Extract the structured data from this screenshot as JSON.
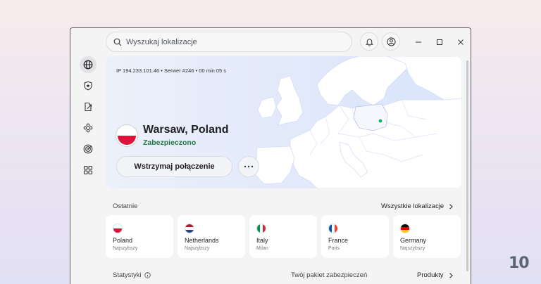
{
  "search": {
    "placeholder": "Wyszukaj lokalizacje"
  },
  "topbar": {
    "icons": [
      "bell-icon",
      "account-icon",
      "minimize-icon",
      "maximize-icon",
      "close-icon"
    ]
  },
  "sidebar": {
    "items": [
      {
        "name": "globe-icon",
        "active": true
      },
      {
        "name": "shield-icon",
        "active": false
      },
      {
        "name": "split-tunnel-icon",
        "active": false
      },
      {
        "name": "mesh-icon",
        "active": false
      },
      {
        "name": "radar-icon",
        "active": false
      },
      {
        "name": "apps-grid-icon",
        "active": false
      }
    ]
  },
  "connection": {
    "ip_line": "IP 194.233.101.46 • Serwer #246 • 00 min 05 s",
    "location": "Warsaw, Poland",
    "status": "Zabezpieczono",
    "pause_label": "Wstrzymaj połączenie",
    "more_label": "⋯"
  },
  "recent": {
    "title": "Ostatnie",
    "all_link": "Wszystkie lokalizacje",
    "items": [
      {
        "name": "Poland",
        "sub": "Najszybszy",
        "flag": [
          "#ffffff",
          "#dc143c"
        ],
        "dir": "h"
      },
      {
        "name": "Netherlands",
        "sub": "Najszybszy",
        "flag": [
          "#ae1c28",
          "#ffffff",
          "#21468b"
        ],
        "dir": "h"
      },
      {
        "name": "Italy",
        "sub": "Milan",
        "flag": [
          "#009246",
          "#ffffff",
          "#ce2b37"
        ],
        "dir": "v"
      },
      {
        "name": "France",
        "sub": "Paris",
        "flag": [
          "#0055a4",
          "#ffffff",
          "#ef4135"
        ],
        "dir": "v"
      },
      {
        "name": "Germany",
        "sub": "Najszybszy",
        "flag": [
          "#000000",
          "#dd0000",
          "#ffce00"
        ],
        "dir": "h"
      }
    ]
  },
  "bottom": {
    "stats_title": "Statystyki",
    "package_title": "Twój pakiet zabezpieczeń",
    "products_link": "Produkty"
  },
  "brand": {
    "logo_text": "10"
  },
  "colors": {
    "secured": "#1f7a44",
    "map_land": "#ffffff",
    "map_sea": "#dfe7fb",
    "marker": "#1fae5b"
  }
}
